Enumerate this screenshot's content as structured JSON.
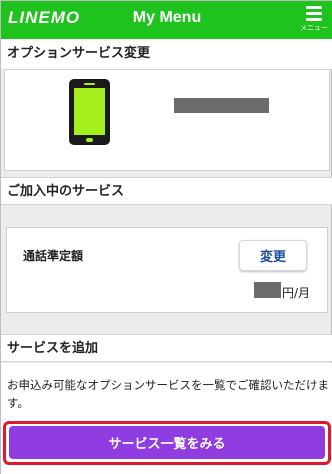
{
  "header": {
    "logo": "LINEMO",
    "title": "My Menu",
    "menu_label": "メニュー",
    "bg_color": "#1ec31e"
  },
  "option_change": {
    "title": "オプションサービス変更",
    "device_icon": "smartphone-icon"
  },
  "subscribed": {
    "title": "ご加入中のサービス",
    "item_label": "通話準定額",
    "change_button": "変更",
    "price_unit": "円/月"
  },
  "add_service": {
    "title": "サービスを追加",
    "description": "お申込み可能なオプションサービスを一覧でご確認いただけます。",
    "cta_label": "サービス一覧をみる",
    "cta_color": "#8f3ce0",
    "highlight_color": "#e0182d"
  }
}
